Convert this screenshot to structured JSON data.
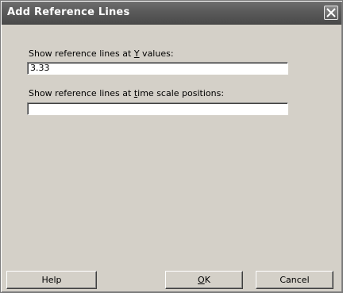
{
  "window": {
    "title": "Add Reference Lines"
  },
  "fields": {
    "y_values": {
      "label_pre": "Show reference lines at ",
      "label_accel": "Y",
      "label_post": " values:",
      "value": "3.33"
    },
    "time_positions": {
      "label_pre": "Show reference lines at ",
      "label_accel": "t",
      "label_post": "ime scale positions:",
      "value": ""
    }
  },
  "buttons": {
    "help": "Help",
    "ok_accel": "O",
    "ok_rest": "K",
    "cancel": "Cancel"
  },
  "icons": {
    "close": "close-icon"
  }
}
